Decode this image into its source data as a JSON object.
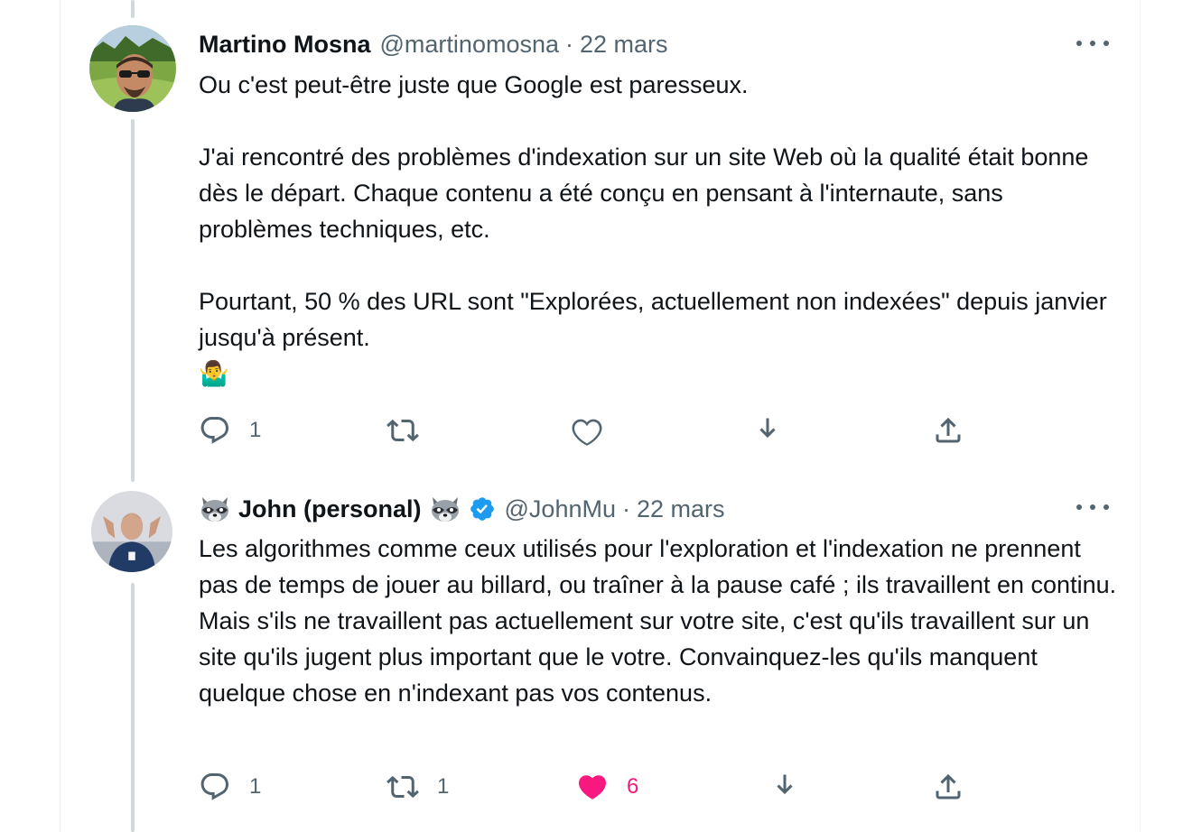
{
  "tweets": [
    {
      "name": "Martino Mosna",
      "handle": "@martinomosna",
      "separator": "·",
      "date": "22 mars",
      "text_p1": "Ou c'est peut-être juste que Google est paresseux.",
      "text_p2": "J'ai rencontré des problèmes d'indexation sur un site Web où la qualité était bonne dès le départ. Chaque contenu a été conçu en pensant à l'internaute, sans problèmes techniques, etc.",
      "text_p3": "Pourtant, 50 % des URL sont \"Explorées, actuellement non indexées\" depuis janvier jusqu'à présent.",
      "text_emoji": "🤷‍♂️",
      "reply_count": "1",
      "retweet_count": "",
      "like_count": "",
      "liked": false
    },
    {
      "name": "John (personal)",
      "name_emoji": "raccoon-icon",
      "verified": true,
      "handle": "@JohnMu",
      "separator": "·",
      "date": "22 mars",
      "text": "Les algorithmes comme ceux utilisés pour l'exploration et l'indexation ne prennent pas de temps de jouer au billard, ou traîner à la pause café ; ils travaillent en continu. Mais s'ils ne travaillent pas actuellement sur votre site, c'est qu'ils travaillent sur un site qu'ils jugent plus important que le votre. Convainquez-les qu'ils manquent quelque chose en n'indexant pas vos contenus.",
      "reply_count": "1",
      "retweet_count": "1",
      "like_count": "6",
      "liked": true
    }
  ],
  "colors": {
    "text": "#0f1419",
    "secondary": "#536471",
    "like": "#f91880",
    "verified": "#1d9bf0",
    "thread_line": "#cfd9de"
  }
}
